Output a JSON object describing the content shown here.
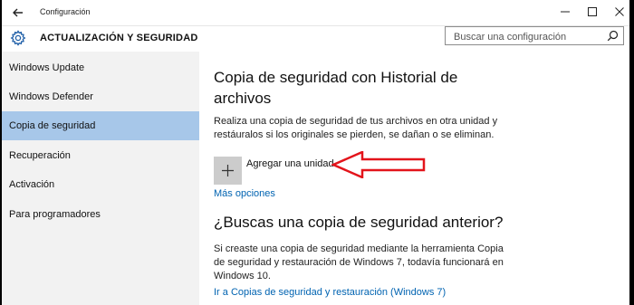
{
  "titlebar": {
    "app_title": "Configuración"
  },
  "header": {
    "title": "ACTUALIZACIÓN Y SEGURIDAD"
  },
  "search": {
    "placeholder": "Buscar una configuración"
  },
  "sidebar": {
    "items": [
      {
        "label": "Windows Update",
        "selected": false
      },
      {
        "label": "Windows Defender",
        "selected": false
      },
      {
        "label": "Copia de seguridad",
        "selected": true
      },
      {
        "label": "Recuperación",
        "selected": false
      },
      {
        "label": "Activación",
        "selected": false
      },
      {
        "label": "Para programadores",
        "selected": false
      }
    ]
  },
  "main": {
    "section1": {
      "title_line1": "Copia de seguridad con Historial de",
      "title_line2": "archivos",
      "desc_line1": "Realiza una copia de seguridad de tus archivos en otra unidad y",
      "desc_line2": "restáuralos si los originales se pierden, se dañan o se eliminan.",
      "add_drive_label": "Agregar una unidad",
      "more_options_link": "Más opciones"
    },
    "section2": {
      "title": "¿Buscas una copia de seguridad anterior?",
      "desc_line1": "Si creaste una copia de seguridad mediante la herramienta Copia",
      "desc_line2": "de seguridad y restauración de Windows 7, todavía funcionará en",
      "desc_line3": "Windows 10.",
      "link": "Ir a Copias de seguridad y restauración (Windows 7)"
    }
  },
  "colors": {
    "selected_nav": "#a7c7e9",
    "link": "#0063b1",
    "annotation_arrow": "#e3141b"
  }
}
